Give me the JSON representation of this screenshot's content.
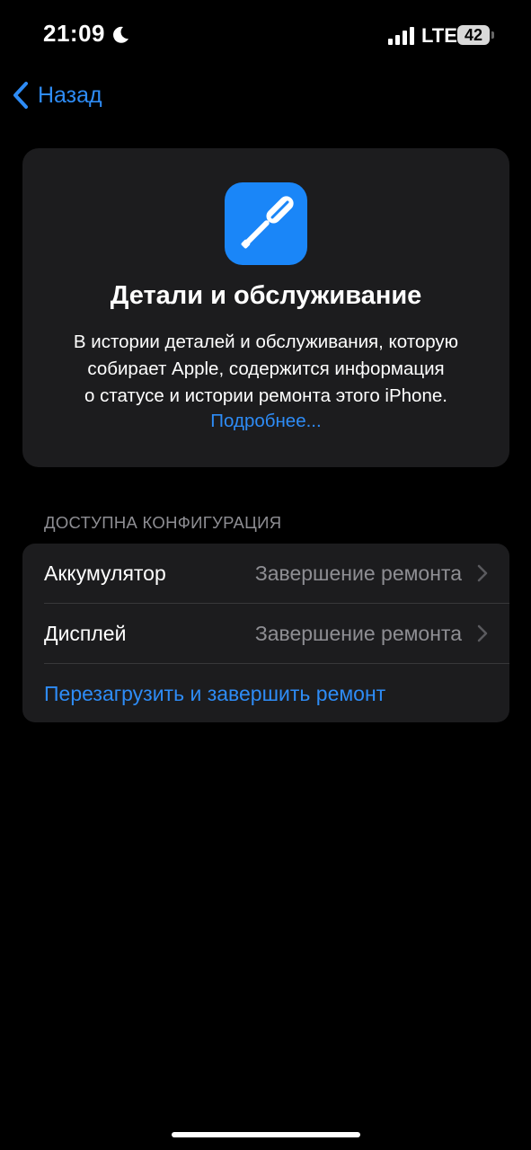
{
  "status_bar": {
    "time": "21:09",
    "network": "LTE",
    "battery": "42",
    "icons": [
      "moon-icon",
      "signal-icon",
      "battery-icon"
    ]
  },
  "nav": {
    "back_label": "Назад",
    "back_icon": "chevron-left-icon"
  },
  "header": {
    "icon": "screwdriver-icon",
    "icon_color": "#1a86f8",
    "title": "Детали и обслуживание",
    "description_lines": [
      "В истории деталей и обслуживания, которую",
      "собирает Apple, содержится информация",
      "о статусе и истории ремонта этого iPhone."
    ],
    "link": "Подробнее..."
  },
  "section": {
    "header": "ДОСТУПНА КОНФИГУРАЦИЯ",
    "rows": [
      {
        "label": "Аккумулятор",
        "value": "Завершение ремонта"
      },
      {
        "label": "Дисплей",
        "value": "Завершение ремонта"
      }
    ],
    "action": "Перезагрузить и завершить ремонт"
  },
  "colors": {
    "accent": "#2e8cf6",
    "background": "#000000",
    "card": "#1c1c1e",
    "secondary_text": "#8e8e93"
  }
}
